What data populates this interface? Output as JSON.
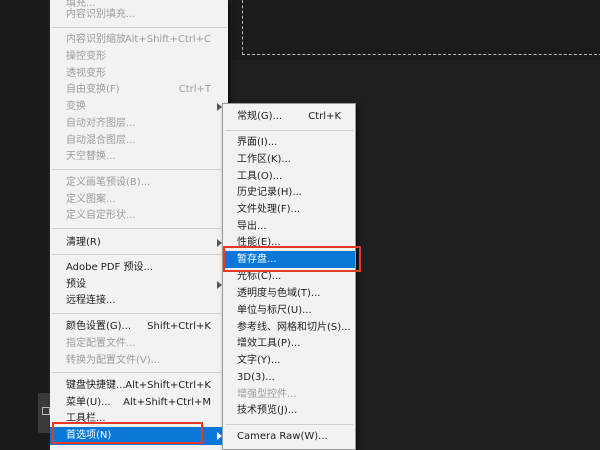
{
  "main_menu": {
    "items": [
      {
        "label": "填充...",
        "shortcut": "",
        "disabled": true
      },
      {
        "label": "内容识别填充...",
        "shortcut": "",
        "disabled": true
      },
      {
        "label": "内容识别缩放",
        "shortcut": "Alt+Shift+Ctrl+C",
        "disabled": true
      },
      {
        "label": "操控变形",
        "shortcut": "",
        "disabled": true
      },
      {
        "label": "透视变形",
        "shortcut": "",
        "disabled": true
      },
      {
        "label": "自由变换(F)",
        "shortcut": "Ctrl+T",
        "disabled": true
      },
      {
        "label": "变换",
        "shortcut": "",
        "disabled": true
      },
      {
        "label": "自动对齐图层...",
        "shortcut": "",
        "disabled": true
      },
      {
        "label": "自动混合图层...",
        "shortcut": "",
        "disabled": true
      },
      {
        "label": "天空替换...",
        "shortcut": "",
        "disabled": true
      },
      {
        "label": "定义画笔预设(B)...",
        "shortcut": "",
        "disabled": true
      },
      {
        "label": "定义图案...",
        "shortcut": "",
        "disabled": true
      },
      {
        "label": "定义自定形状...",
        "shortcut": "",
        "disabled": true
      },
      {
        "label": "清理(R)",
        "shortcut": "",
        "disabled": false
      },
      {
        "label": "Adobe PDF 预设...",
        "shortcut": "",
        "disabled": false
      },
      {
        "label": "预设",
        "shortcut": "",
        "disabled": false
      },
      {
        "label": "远程连接...",
        "shortcut": "",
        "disabled": false
      },
      {
        "label": "颜色设置(G)...",
        "shortcut": "Shift+Ctrl+K",
        "disabled": false
      },
      {
        "label": "指定配置文件...",
        "shortcut": "",
        "disabled": true
      },
      {
        "label": "转换为配置文件(V)...",
        "shortcut": "",
        "disabled": true
      },
      {
        "label": "键盘快捷键...",
        "shortcut": "Alt+Shift+Ctrl+K",
        "disabled": false
      },
      {
        "label": "菜单(U)...",
        "shortcut": "Alt+Shift+Ctrl+M",
        "disabled": false
      },
      {
        "label": "工具栏...",
        "shortcut": "",
        "disabled": false
      },
      {
        "label": "首选项(N)",
        "shortcut": "",
        "disabled": false
      }
    ]
  },
  "sub_menu": {
    "items": [
      {
        "label": "常规(G)...",
        "shortcut": "Ctrl+K"
      },
      {
        "label": "界面(I)...",
        "shortcut": ""
      },
      {
        "label": "工作区(K)...",
        "shortcut": ""
      },
      {
        "label": "工具(O)...",
        "shortcut": ""
      },
      {
        "label": "历史记录(H)...",
        "shortcut": ""
      },
      {
        "label": "文件处理(F)...",
        "shortcut": ""
      },
      {
        "label": "导出...",
        "shortcut": ""
      },
      {
        "label": "性能(E)...",
        "shortcut": ""
      },
      {
        "label": "暂存盘...",
        "shortcut": ""
      },
      {
        "label": "光标(C)...",
        "shortcut": ""
      },
      {
        "label": "透明度与色域(T)...",
        "shortcut": ""
      },
      {
        "label": "单位与标尺(U)...",
        "shortcut": ""
      },
      {
        "label": "参考线、网格和切片(S)...",
        "shortcut": ""
      },
      {
        "label": "增效工具(P)...",
        "shortcut": ""
      },
      {
        "label": "文字(Y)...",
        "shortcut": ""
      },
      {
        "label": "3D(3)...",
        "shortcut": ""
      },
      {
        "label": "增强型控件...",
        "shortcut": ""
      },
      {
        "label": "技术预览(J)...",
        "shortcut": ""
      },
      {
        "label": "Camera Raw(W)...",
        "shortcut": ""
      }
    ]
  },
  "colors": {
    "highlight": "#0b78d7",
    "annotation": "#e53a26"
  }
}
